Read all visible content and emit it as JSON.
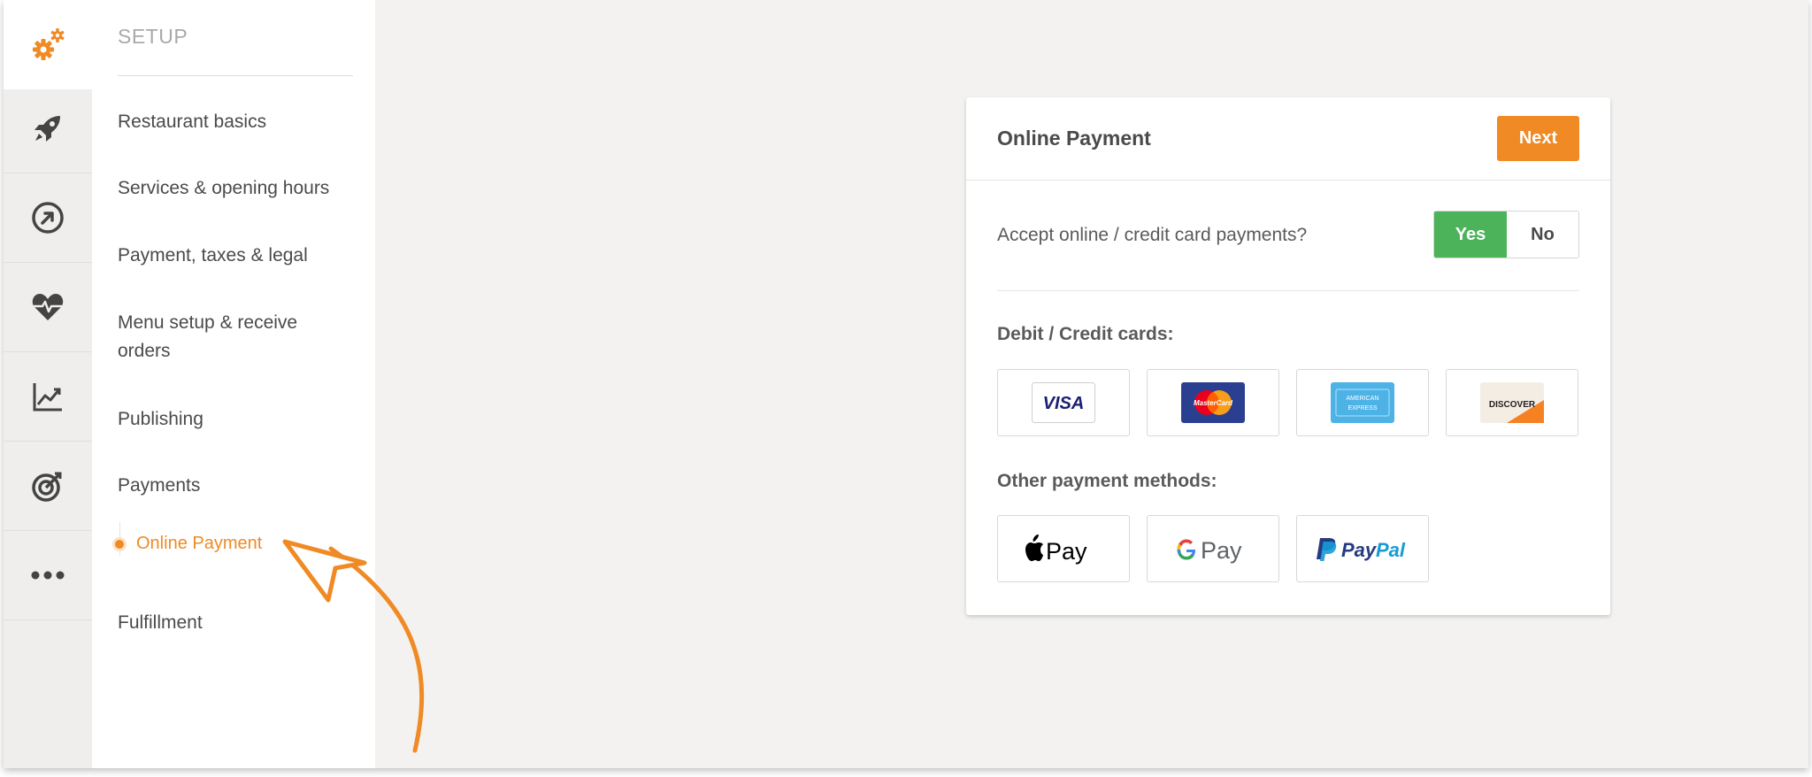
{
  "sidebar": {
    "title": "SETUP",
    "items": [
      {
        "label": "Restaurant basics"
      },
      {
        "label": "Services & opening hours"
      },
      {
        "label": "Payment, taxes & legal"
      },
      {
        "label": "Menu setup & receive orders"
      },
      {
        "label": "Publishing"
      },
      {
        "label": "Payments"
      },
      {
        "label": "Fulfillment"
      }
    ],
    "active_subitem": "Online Payment"
  },
  "rail_icons": [
    "gears-icon",
    "rocket-icon",
    "arrow-circle-icon",
    "heart-pulse-icon",
    "chart-line-icon",
    "target-icon",
    "more-icon"
  ],
  "card": {
    "title": "Online Payment",
    "next_label": "Next",
    "question": "Accept online / credit card payments?",
    "yes_label": "Yes",
    "no_label": "No",
    "selected": "Yes",
    "cards_label": "Debit / Credit cards:",
    "other_label": "Other payment methods:",
    "cards": [
      "VISA",
      "MasterCard",
      "AMERICAN EXPRESS",
      "DISCOVER"
    ],
    "other_methods": [
      "Apple Pay",
      "G Pay",
      "PayPal"
    ]
  },
  "colors": {
    "accent": "#f08a24",
    "yes_green": "#4cb35a",
    "background": "#f3f2f0"
  }
}
